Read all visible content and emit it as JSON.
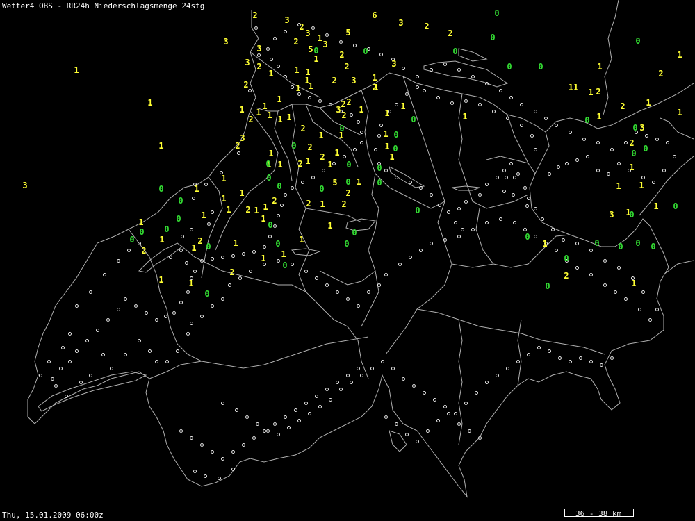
{
  "title": "Wetter4 OBS - RR24h Niederschlagsmenge 24stg",
  "timestamp": "Thu, 15.01.2009 06:00z",
  "scale_label": "36 - 38 km",
  "colors": {
    "background": "#000000",
    "border": "#b0b0b0",
    "text": "#ffffff",
    "value_positive": "#ffff33",
    "value_zero": "#33dd33"
  },
  "icons": {
    "station": "station-dot-icon"
  },
  "observations": [
    "2",
    "3",
    "2",
    "3",
    "6",
    "3",
    "2",
    "2",
    "3",
    "3",
    "2",
    "5",
    "1",
    "3",
    "0",
    "1",
    "5",
    "0",
    "0",
    "2",
    "0",
    "3",
    "2",
    "3",
    "2",
    "1",
    "1",
    "1",
    "0",
    "0",
    "0",
    "0",
    "1",
    "1",
    "1",
    "1",
    "1",
    "2",
    "1",
    "2",
    "3",
    "1",
    "1",
    "2",
    "11",
    "1",
    "2",
    "1",
    "1",
    "2",
    "1",
    "1",
    "2",
    "1",
    "1",
    "2",
    "2",
    "1",
    "2",
    "3",
    "2",
    "3",
    "1",
    "1",
    "1",
    "1",
    "1",
    "1",
    "1",
    "0",
    "0",
    "1",
    "2",
    "1",
    "0",
    "1",
    "0",
    "1",
    "0",
    "3",
    "2",
    "1",
    "2",
    "1",
    "0",
    "2",
    "1",
    "0",
    "0",
    "1",
    "2",
    "1",
    "1",
    "1",
    "2",
    "1",
    "0",
    "1",
    "0",
    "0",
    "0",
    "0",
    "0",
    "1",
    "1",
    "0",
    "1",
    "1",
    "1",
    "1",
    "0",
    "0",
    "5",
    "0",
    "1",
    "3",
    "0",
    "1",
    "2",
    "2",
    "2",
    "1",
    "2",
    "0",
    "1",
    "1",
    "2",
    "1",
    "1",
    "1",
    "0",
    "1",
    "1",
    "0",
    "3",
    "1",
    "0",
    "0",
    "0",
    "0",
    "1",
    "0",
    "0",
    "1",
    "2",
    "0",
    "1",
    "0",
    "1",
    "0",
    "0",
    "1",
    "0",
    "0",
    "0",
    "0",
    "2",
    "1",
    "1",
    "1",
    "0",
    "0",
    "2",
    "2",
    "1",
    "1",
    "0",
    "1",
    "0"
  ]
}
